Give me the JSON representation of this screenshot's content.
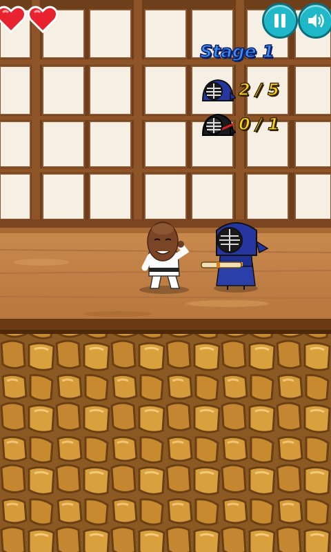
{
  "hud": {
    "lives": {
      "count": 2,
      "icon": "heart-icon",
      "color": "#e8222e"
    },
    "pause_icon": "pause-icon",
    "sound_icon": "speaker-icon",
    "button_color": "#1fb8c8"
  },
  "stage": {
    "label": "Stage 1"
  },
  "enemy_counters": [
    {
      "enemy": "blue-kendo-fighter",
      "text": "2 / 5",
      "defeated": 2,
      "total": 5
    },
    {
      "enemy": "black-kendo-fighter",
      "text": "0 / 1",
      "defeated": 0,
      "total": 1
    }
  ],
  "characters": {
    "player": "karate-player",
    "enemy": "kendo-enemy"
  }
}
